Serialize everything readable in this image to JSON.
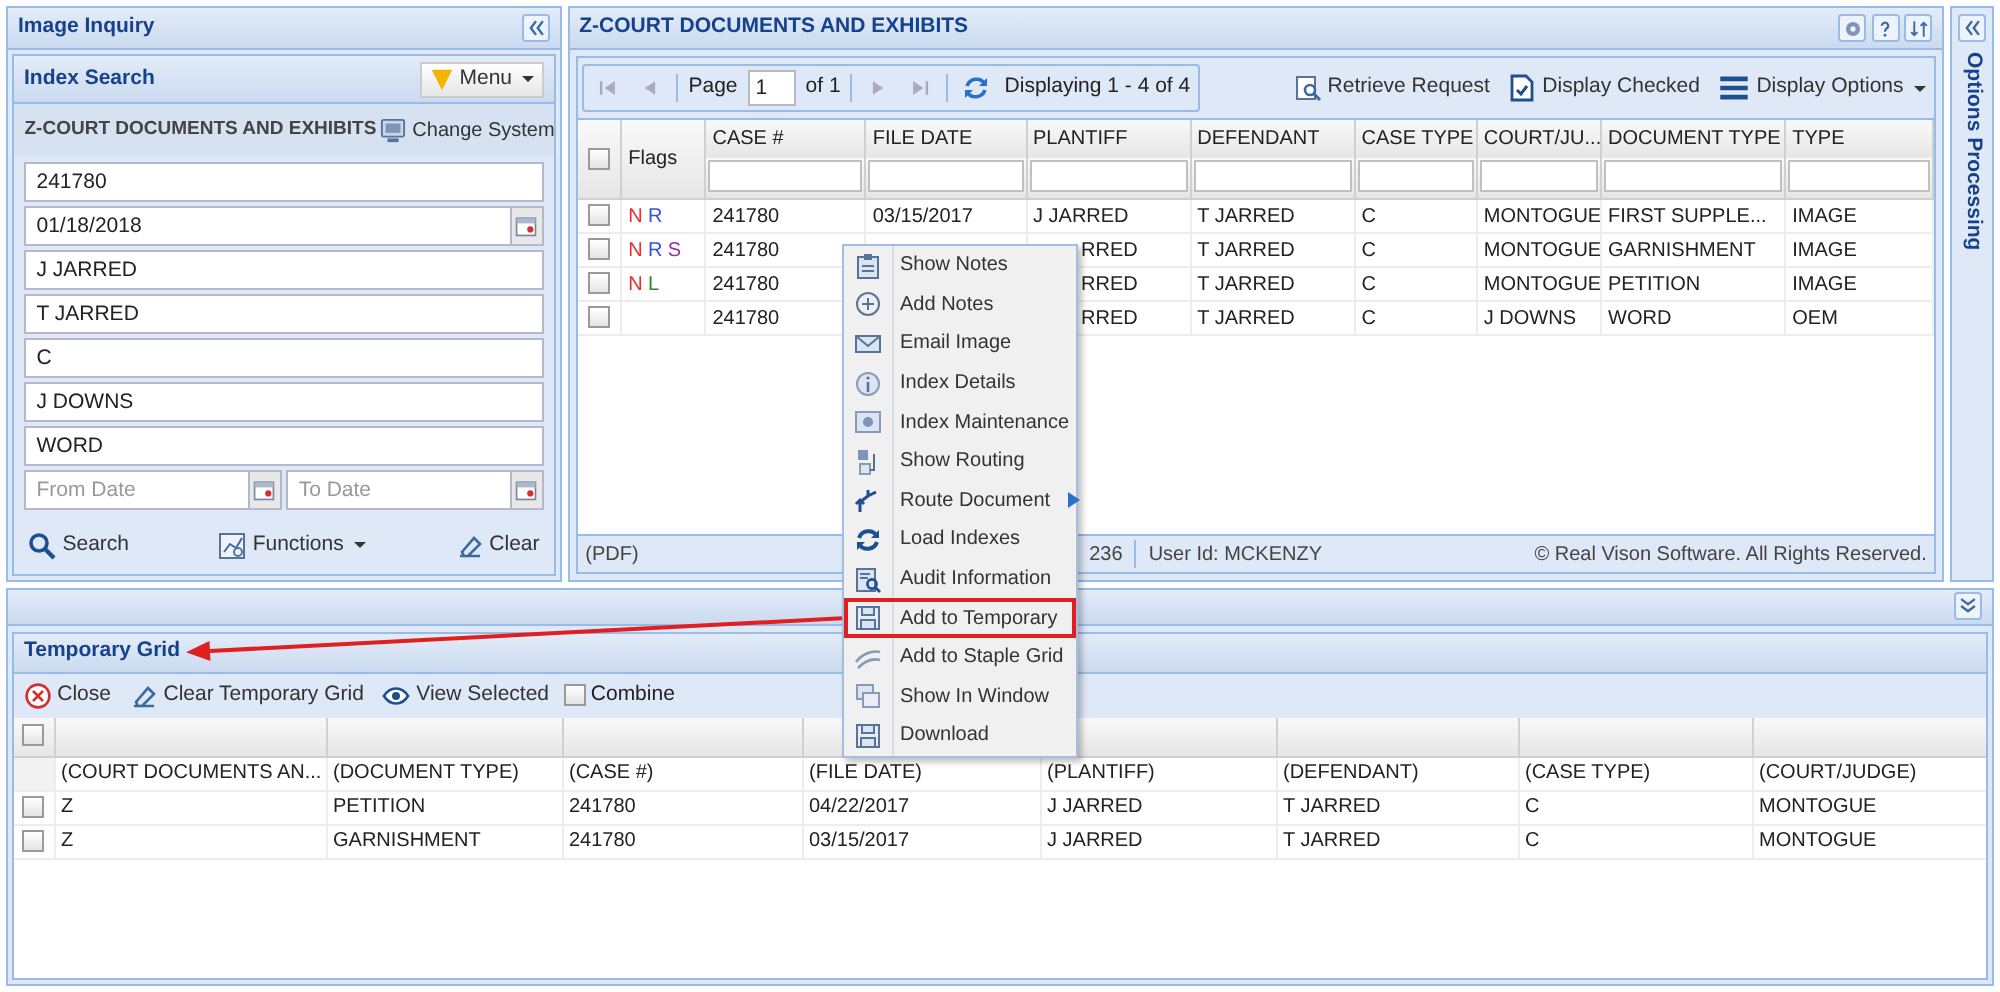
{
  "left_panel": {
    "title": "Image Inquiry",
    "subtitle": "Index Search",
    "menu_button": "Menu",
    "system_title": "Z-COURT DOCUMENTS AND EXHIBITS",
    "change_system": "Change System",
    "fields": [
      {
        "kind": "text",
        "value": "241780"
      },
      {
        "kind": "date",
        "value": "01/18/2018"
      },
      {
        "kind": "text",
        "value": "J JARRED"
      },
      {
        "kind": "text",
        "value": "T JARRED"
      },
      {
        "kind": "text",
        "value": "C"
      },
      {
        "kind": "text",
        "value": "J DOWNS"
      },
      {
        "kind": "text",
        "value": "WORD"
      },
      {
        "kind": "date_range",
        "from_placeholder": "From Date",
        "to_placeholder": "To Date"
      }
    ],
    "actions": [
      {
        "label": "Search",
        "dropdown": false
      },
      {
        "label": "Functions",
        "dropdown": true
      },
      {
        "label": "Clear",
        "dropdown": false
      }
    ]
  },
  "main_panel": {
    "title": "Z-COURT DOCUMENTS AND EXHIBITS",
    "pager": {
      "page_label": "Page",
      "page": "1",
      "of": "of 1",
      "displaying": "Displaying 1 - 4 of 4"
    },
    "toolbar": [
      {
        "label": "Retrieve Request",
        "dropdown": false
      },
      {
        "label": "Display Checked",
        "dropdown": false
      },
      {
        "label": "Display Options",
        "dropdown": true
      }
    ],
    "header_checked": false,
    "flags_column": "Flags",
    "columns": [
      "CASE #",
      "FILE DATE",
      "PLANTIFF",
      "DEFENDANT",
      "CASE TYPE",
      "COURT/JU...",
      "DOCUMENT TYPE",
      "TYPE"
    ],
    "rows": [
      {
        "checked": false,
        "covered": false,
        "flags": [
          {
            "text": "N",
            "color": "#e8302c"
          },
          {
            "text": "R",
            "color": "#3550e0"
          }
        ],
        "cells": [
          "241780",
          "03/15/2017",
          "J JARRED",
          "T JARRED",
          "C",
          "MONTOGUE",
          "FIRST SUPPLE...",
          "IMAGE"
        ]
      },
      {
        "checked": false,
        "covered": true,
        "flags": [
          {
            "text": "N",
            "color": "#e8302c"
          },
          {
            "text": "R",
            "color": "#3550e0"
          },
          {
            "text": "S",
            "color": "#9a2fa0"
          }
        ],
        "cells": [
          "241780",
          null,
          "RRED",
          "T JARRED",
          "C",
          "MONTOGUE",
          "GARNISHMENT",
          "IMAGE"
        ]
      },
      {
        "checked": false,
        "covered": true,
        "flags": [
          {
            "text": "N",
            "color": "#e8302c"
          },
          {
            "text": "L",
            "color": "#2a8a2a"
          }
        ],
        "cells": [
          "241780",
          null,
          "RRED",
          "T JARRED",
          "C",
          "MONTOGUE",
          "PETITION",
          "IMAGE"
        ]
      },
      {
        "checked": false,
        "covered": true,
        "flags": [],
        "cells": [
          "241780",
          null,
          "RRED",
          "T JARRED",
          "C",
          "J DOWNS",
          "WORD",
          "OEM"
        ]
      }
    ],
    "status_bar": {
      "format": "(PDF)",
      "fragment": "236",
      "user": "User Id: MCKENZY",
      "copyright": "© Real Vison Software. All Rights Reserved."
    }
  },
  "options_panel": {
    "title": "Options Processing"
  },
  "context_menu": {
    "items": [
      {
        "label": "Show Notes",
        "kind": "command",
        "highlighted": false
      },
      {
        "label": "Add Notes",
        "kind": "command",
        "highlighted": false
      },
      {
        "label": "Email Image",
        "kind": "command",
        "highlighted": false
      },
      {
        "label": "Index Details",
        "kind": "command",
        "highlighted": false
      },
      {
        "label": "Index Maintenance",
        "kind": "command",
        "highlighted": false
      },
      {
        "label": "Show Routing",
        "kind": "command",
        "highlighted": false
      },
      {
        "label": "Route Document",
        "kind": "submenu",
        "highlighted": false
      },
      {
        "label": "Load Indexes",
        "kind": "command",
        "highlighted": false
      },
      {
        "label": "Audit Information",
        "kind": "command",
        "highlighted": false
      },
      {
        "label": "Add to Temporary",
        "kind": "command",
        "highlighted": true
      },
      {
        "label": "Add to Staple Grid",
        "kind": "command",
        "highlighted": false
      },
      {
        "label": "Show In Window",
        "kind": "command",
        "highlighted": false
      },
      {
        "label": "Download",
        "kind": "command",
        "highlighted": false
      }
    ]
  },
  "temporary_grid": {
    "title": "Temporary Grid",
    "toolbar": [
      {
        "label": "Close"
      },
      {
        "label": "Clear Temporary Grid"
      },
      {
        "label": "View Selected"
      }
    ],
    "combine": {
      "label": "Combine",
      "checked": false
    },
    "header_checked": false,
    "field_row": [
      "(COURT DOCUMENTS AN...",
      "(DOCUMENT TYPE)",
      "(CASE #)",
      "(FILE DATE)",
      "(PLANTIFF)",
      "(DEFENDANT)",
      "(CASE TYPE)",
      "(COURT/JUDGE)"
    ],
    "rows": [
      {
        "checked": false,
        "cells": [
          "Z",
          "PETITION",
          "241780",
          "04/22/2017",
          "J JARRED",
          "T JARRED",
          "C",
          "MONTOGUE"
        ]
      },
      {
        "checked": false,
        "cells": [
          "Z",
          "GARNISHMENT",
          "241780",
          "03/15/2017",
          "J JARRED",
          "T JARRED",
          "C",
          "MONTOGUE"
        ]
      }
    ]
  }
}
